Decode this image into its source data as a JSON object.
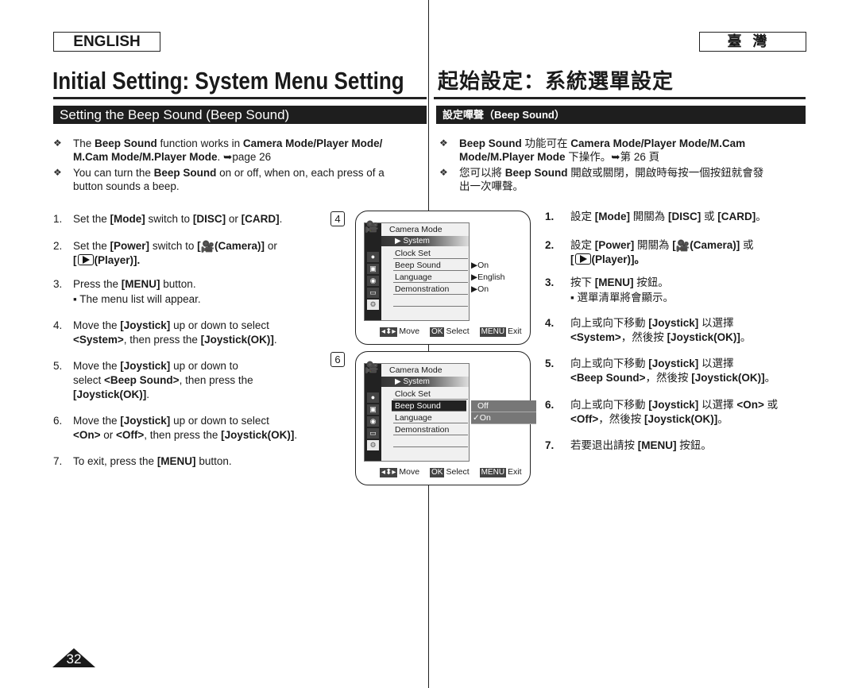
{
  "header": {
    "lang_en": "ENGLISH",
    "lang_tw": "臺灣",
    "title_en": "Initial Setting: System Menu Setting",
    "title_tw": "起始設定：系統選單設定",
    "section_en": "Setting the Beep Sound (Beep Sound)",
    "section_tw": "設定嗶聲（Beep Sound）"
  },
  "notes_en": [
    {
      "line1_a": "The ",
      "line1_b": "Beep Sound",
      "line1_c": " function works in ",
      "line1_d": "Camera Mode/Player Mode/",
      "line2_a": "M.Cam Mode/M.Player Mode",
      "line2_b": ". ➥page 26"
    },
    {
      "line1_a": "You can turn the ",
      "line1_b": "Beep Sound",
      "line1_c": " on or off, when on, each press of a",
      "line2_a": "button sounds a beep."
    }
  ],
  "notes_tw": [
    {
      "line1_a": "Beep Sound",
      "line1_b": " 功能可在 ",
      "line1_c": "Camera Mode/Player Mode/M.Cam",
      "line2_a": "Mode/M.Player Mode",
      "line2_b": " 下操作。➥第 26 頁"
    },
    {
      "line1_a": "您可以將 ",
      "line1_b": "Beep Sound",
      "line1_c": " 開啟或關閉，開啟時每按一個按鈕就會發",
      "line2_a": "出一次嗶聲。"
    }
  ],
  "steps_en": [
    {
      "num": "1.",
      "a": "Set the ",
      "b": "[Mode]",
      "c": " switch to ",
      "d": "[DISC]",
      "e": " or ",
      "f": "[CARD]",
      "g": "."
    },
    {
      "num": "2.",
      "a": "Set the ",
      "b": "[Power]",
      "c": " switch to ",
      "d": "[",
      "e": "(Camera)]",
      "f": " or",
      "line2": "(Player)]."
    },
    {
      "num": "3.",
      "a": "Press the ",
      "b": "[MENU]",
      "c": " button.",
      "sub": "▪  The menu list will appear."
    },
    {
      "num": "4.",
      "a": "Move the ",
      "b": "[Joystick]",
      "c": " up or down to select",
      "line2_a": "<System>",
      "line2_b": ", then press the ",
      "line2_c": "[Joystick(OK)]",
      "line2_d": "."
    },
    {
      "num": "5.",
      "a": "Move the ",
      "b": "[Joystick]",
      "c": " up or down to",
      "line2_a": "select ",
      "line2_b": "<Beep Sound>",
      "line2_c": ", then press the",
      "line3": "[Joystick(OK)]",
      "line3_b": "."
    },
    {
      "num": "6.",
      "a": "Move the ",
      "b": "[Joystick]",
      "c": " up or down to select",
      "line2_a": "<On>",
      "line2_b": " or ",
      "line2_c": "<Off>",
      "line2_d": ", then press the ",
      "line2_e": "[Joystick(OK)]",
      "line2_f": "."
    },
    {
      "num": "7.",
      "a": "To exit, press the ",
      "b": "[MENU]",
      "c": " button."
    }
  ],
  "steps_tw": [
    {
      "num": "1.",
      "a": "設定 ",
      "b": "[Mode]",
      "c": " 開關為 ",
      "d": "[DISC]",
      "e": " 或 ",
      "f": "[CARD]",
      "g": "。"
    },
    {
      "num": "2.",
      "a": "設定 ",
      "b": "[Power]",
      "c": " 開關為 ",
      "d": "[",
      "e": "(Camera)]",
      "f": " 或",
      "line2": "(Player)]。"
    },
    {
      "num": "3.",
      "a": "按下 ",
      "b": "[MENU]",
      "c": " 按鈕。",
      "sub": "▪  選單清單將會顯示。"
    },
    {
      "num": "4.",
      "a": "向上或向下移動 ",
      "b": "[Joystick]",
      "c": " 以選擇",
      "line2_a": "<System>",
      "line2_b": "，然後按 ",
      "line2_c": "[Joystick(OK)]",
      "line2_d": "。"
    },
    {
      "num": "5.",
      "a": "向上或向下移動 ",
      "b": "[Joystick]",
      "c": " 以選擇",
      "line2_a": "<Beep Sound>",
      "line2_b": "，然後按 ",
      "line2_c": "[Joystick(OK)]",
      "line2_d": "。"
    },
    {
      "num": "6.",
      "a": "向上或向下移動 ",
      "b": "[Joystick]",
      "c": " 以選擇 ",
      "d": "<On>",
      "e": " 或",
      "line2_a": "<Off>",
      "line2_b": "，然後按 ",
      "line2_c": "[Joystick(OK)]",
      "line2_d": "。"
    },
    {
      "num": "7.",
      "a": "若要退出請按 ",
      "b": "[MENU]",
      "c": " 按鈕。"
    }
  ],
  "screens": [
    {
      "badge": "4",
      "header": "Camera Mode",
      "system": "System",
      "items": [
        "Clock Set",
        "Beep Sound",
        "Language",
        "Demonstration"
      ],
      "values": [
        "",
        "On",
        "English",
        "On"
      ],
      "hint_move": "Move",
      "hint_ok_key": "OK",
      "hint_select": "Select",
      "hint_menu_key": "MENU",
      "hint_exit": "Exit"
    },
    {
      "badge": "6",
      "header": "Camera Mode",
      "system": "System",
      "items": [
        "Clock Set",
        "Beep Sound",
        "Language",
        "Demonstration"
      ],
      "popup": [
        "Off",
        "✓On"
      ],
      "hint_move": "Move",
      "hint_ok_key": "OK",
      "hint_select": "Select",
      "hint_menu_key": "MENU",
      "hint_exit": "Exit"
    }
  ],
  "page_number": "32"
}
